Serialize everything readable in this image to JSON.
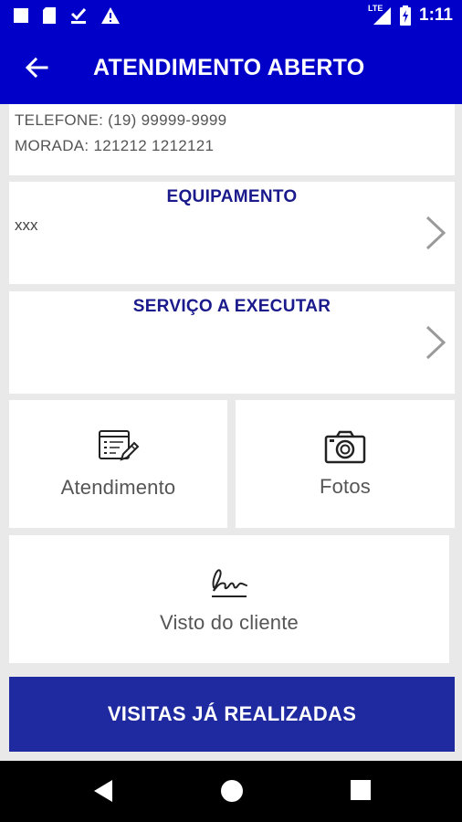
{
  "status_bar": {
    "time": "1:11",
    "network_label": "LTE",
    "icons": [
      "square-icon",
      "sd-card-icon",
      "download-done-icon",
      "warning-icon",
      "signal-icon",
      "battery-charging-icon"
    ]
  },
  "app_bar": {
    "title": "ATENDIMENTO ABERTO",
    "back_icon": "arrow-left-icon"
  },
  "info": {
    "telefone": "TELEFONE: (19) 99999-9999",
    "morada": "MORADA: 121212 1212121"
  },
  "equipamento": {
    "title": "EQUIPAMENTO",
    "value": "xxx"
  },
  "servico": {
    "title": "SERVIÇO A EXECUTAR",
    "value": ""
  },
  "tiles": {
    "atendimento": {
      "label": "Atendimento",
      "icon": "form-edit-icon"
    },
    "fotos": {
      "label": "Fotos",
      "icon": "camera-icon"
    },
    "visto": {
      "label": "Visto do cliente",
      "icon": "signature-icon"
    }
  },
  "visitas_button": {
    "label": "VISITAS JÁ REALIZADAS"
  },
  "colors": {
    "primary": "#0000c8",
    "button": "#1f2aa0",
    "section_title": "#1a1a8c",
    "background": "#e9e9e9"
  }
}
